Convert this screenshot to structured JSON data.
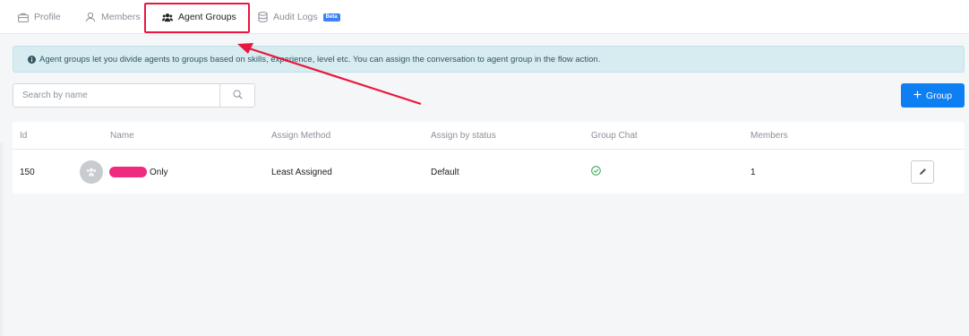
{
  "tabs": [
    {
      "label": "Profile",
      "icon": "briefcase-icon"
    },
    {
      "label": "Members",
      "icon": "user-icon"
    },
    {
      "label": "Agent Groups",
      "icon": "users-icon",
      "active": true
    },
    {
      "label": "Audit Logs",
      "icon": "database-icon",
      "badge": "Beta"
    }
  ],
  "alert": {
    "text": "Agent groups let you divide agents to groups based on skills, experience, level etc. You can assign the conversation to agent group in the flow action.",
    "icon": "info-circle-icon"
  },
  "search": {
    "placeholder": "Search by name",
    "value": ""
  },
  "add_group_button": {
    "label": "Group",
    "icon": "plus-icon"
  },
  "table": {
    "headers": [
      "Id",
      "Name",
      "Assign Method",
      "Assign by status",
      "Group Chat",
      "Members"
    ],
    "rows": [
      {
        "id": "150",
        "name_visible": "Only",
        "assign_method": "Least Assigned",
        "assign_by_status": "Default",
        "group_chat": "check-circle-icon",
        "members": "1"
      }
    ]
  },
  "colors": {
    "accent": "#0d7ff2",
    "alert_bg": "#d7ecf1",
    "highlight": "#e8173f",
    "success": "#2ea44f"
  }
}
